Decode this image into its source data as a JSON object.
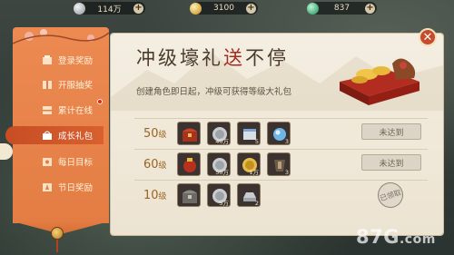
{
  "currency": [
    {
      "icon": "silver-coin-icon",
      "value": "114万",
      "color": "#b8bcbf"
    },
    {
      "icon": "gold-ingot-icon",
      "value": "3100",
      "color": "#e8b93f"
    },
    {
      "icon": "jade-orb-icon",
      "value": "837",
      "color": "#4fc28a"
    }
  ],
  "plus_label": "+",
  "sidebar": {
    "items": [
      {
        "label": "登录奖励",
        "icon": "login-reward-icon"
      },
      {
        "label": "开服抽奖",
        "icon": "server-lottery-icon"
      },
      {
        "label": "累计在线",
        "icon": "online-time-icon",
        "badge": true
      },
      {
        "label": "成长礼包",
        "icon": "growth-pack-icon",
        "active": true
      },
      {
        "label": "每日目标",
        "icon": "daily-goal-icon"
      },
      {
        "label": "节日奖励",
        "icon": "festival-reward-icon"
      }
    ]
  },
  "header": {
    "title_part1": "冲级壕礼",
    "title_part2": "送",
    "title_part3": "不停",
    "subtitle": "创建角色即日起，冲级可获得等级大礼包",
    "close_label": "✕"
  },
  "rows": [
    {
      "level": "50",
      "level_unit": "级",
      "items": [
        {
          "icon": "treasure-chest-icon",
          "qty": ""
        },
        {
          "icon": "silver-coin-icon",
          "qty": "40万"
        },
        {
          "icon": "scroll-icon",
          "qty": "5"
        },
        {
          "icon": "blue-orb-icon",
          "qty": "3"
        }
      ],
      "action": "未达到"
    },
    {
      "level": "60",
      "level_unit": "级",
      "items": [
        {
          "icon": "red-pouch-icon",
          "qty": ""
        },
        {
          "icon": "silver-coin-icon",
          "qty": "50万"
        },
        {
          "icon": "gold-coin-icon",
          "qty": "1万"
        },
        {
          "icon": "armor-icon",
          "qty": "3"
        }
      ],
      "action": "未达到"
    },
    {
      "level": "10",
      "level_unit": "级",
      "items": [
        {
          "icon": "iron-chest-icon",
          "qty": ""
        },
        {
          "icon": "silver-coin-icon",
          "qty": "5万"
        },
        {
          "icon": "silver-ingot-icon",
          "qty": "2"
        }
      ],
      "action": "已领取"
    }
  ],
  "watermark": {
    "main": "87G",
    "rest": ".com"
  }
}
